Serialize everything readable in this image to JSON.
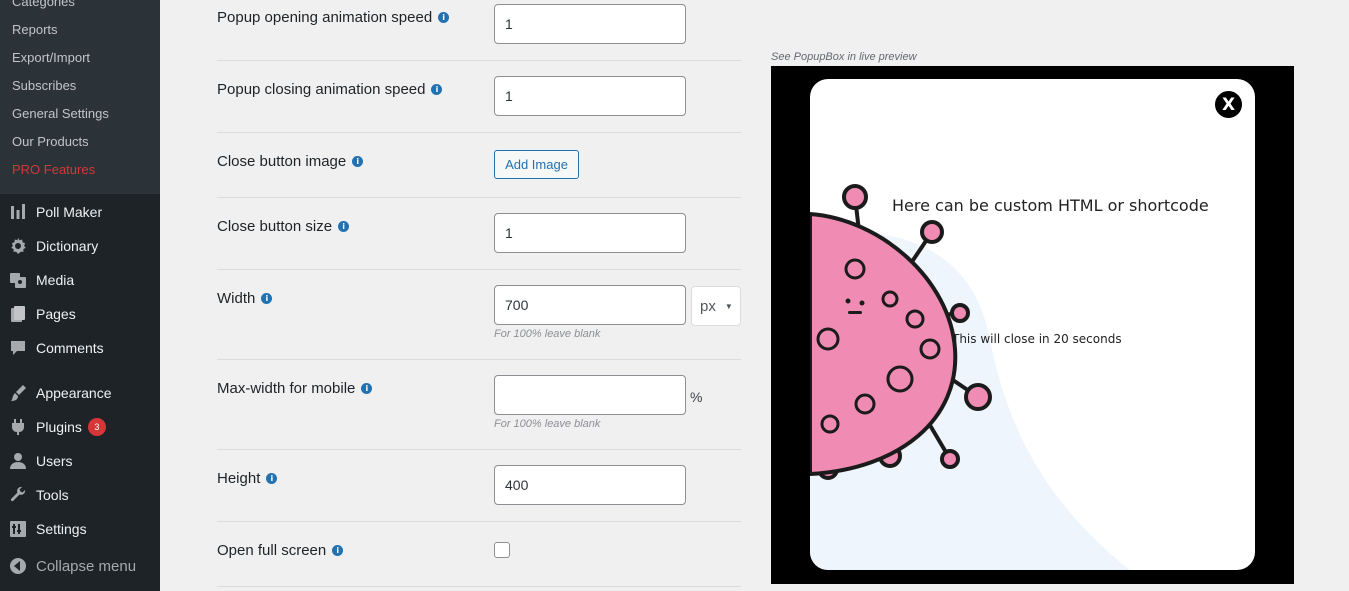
{
  "sidebar": {
    "submenu": [
      "Categories",
      "Reports",
      "Export/Import",
      "Subscribes",
      "General Settings",
      "Our Products",
      "PRO Features"
    ],
    "menu": [
      {
        "label": "Poll Maker",
        "icon": "chart-bars-icon"
      },
      {
        "label": "Dictionary",
        "icon": "gear-icon"
      },
      {
        "label": "Media",
        "icon": "media-icon"
      },
      {
        "label": "Pages",
        "icon": "pages-icon"
      },
      {
        "label": "Comments",
        "icon": "comment-icon"
      },
      {
        "label": "Appearance",
        "icon": "paintbrush-icon"
      },
      {
        "label": "Plugins",
        "icon": "plugin-icon",
        "badge": "3"
      },
      {
        "label": "Users",
        "icon": "user-icon"
      },
      {
        "label": "Tools",
        "icon": "wrench-icon"
      },
      {
        "label": "Settings",
        "icon": "settings-icon"
      }
    ],
    "collapse_label": "Collapse menu"
  },
  "form": {
    "opening_speed": {
      "label": "Popup opening animation speed",
      "value": "1"
    },
    "closing_speed": {
      "label": "Popup closing animation speed",
      "value": "1"
    },
    "close_image": {
      "label": "Close button image",
      "button": "Add Image"
    },
    "close_size": {
      "label": "Close button size",
      "value": "1"
    },
    "width": {
      "label": "Width",
      "value": "700",
      "unit": "px",
      "hint": "For 100% leave blank"
    },
    "max_width_mobile": {
      "label": "Max-width for mobile",
      "value": "",
      "unit": "%",
      "hint": "For 100% leave blank"
    },
    "height": {
      "label": "Height",
      "value": "400"
    },
    "full_screen": {
      "label": "Open full screen",
      "checked": false
    }
  },
  "preview": {
    "caption": "See PopupBox in live preview",
    "content_text": "Here can be custom HTML or shortcode",
    "timer_text": "This will close in 20 seconds",
    "close_label": "X"
  },
  "colors": {
    "sidebar_bg": "#1d2327",
    "accent": "#2271b1",
    "pro_red": "#d63638",
    "virus_pink": "#f08cb4"
  }
}
